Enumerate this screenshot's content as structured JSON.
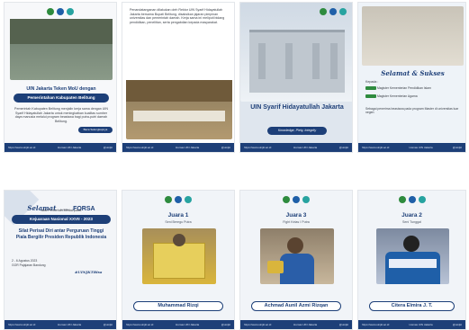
{
  "posts": [
    {
      "headline": "UIN Jakarta Teken MoU dengan",
      "headline2": "Pemerintahan Kabupaten Belitung",
      "body": "Pemerintah Kabupaten Belitung menjalin kerja sama dengan UIN Syarif Hidayatullah Jakarta untuk meningkatkan kualitas sumber daya manusia melalui program beasiswa bagi putra-putri daerah Belitung.",
      "button": "Baca Selengkapnya",
      "footer_left": "https://www.uinjkt.ac.id",
      "footer_mid": "Humas UIN Jakarta",
      "footer_right": "@uinjkt"
    },
    {
      "body": "Penandatanganan dilakukan oleh Rektor UIN Syarif Hidayatullah Jakarta bersama Bupati Belitung, disaksikan jajaran pimpinan universitas dan pemerintah daerah. Kerja sama ini meliputi bidang pendidikan, penelitian, serta pengabdian kepada masyarakat.",
      "footer_left": "https://www.uinjkt.ac.id",
      "footer_mid": "Humas UIN Jakarta",
      "footer_right": "@uinjkt"
    },
    {
      "title": "UIN Syarif Hidayatullah Jakarta",
      "tagline": "Knowledge, Piety, Integrity",
      "footer_left": "https://www.uinjkt.ac.id",
      "footer_mid": "Humas UIN Jakarta",
      "footer_right": "@uinjkt"
    },
    {
      "heading": "Selamat & Sukses",
      "intro": "Kepada :",
      "item1": "Magister Kementerian Pendidikan Islam",
      "item2": "Magister Kementerian Agama",
      "body": "Sebagai penerima beasiswa pada program Master di universitas luar negeri.",
      "footer_left": "https://www.uinjkt.ac.id",
      "footer_mid": "Humas UIN Jakarta",
      "footer_right": "@uinjkt"
    },
    {
      "selamat": "Selamat",
      "kepada": "kepada",
      "forsa": "FORSA",
      "subtitle": "atas Perolehan Medali pada",
      "event": "Kejuaraan Nasional XXVII - 2023",
      "desc": "Silat Perisai Diri antar Perguruan Tinggi Piala Bergilir Presiden Republik Indonesia",
      "date": "2 - 6 Agustus 2023",
      "venue": "GOR Pajajaran Bandung",
      "tag": "#UINJKTBisa",
      "footer_left": "https://www.uinjkt.ac.id",
      "footer_mid": "Humas UIN Jakarta",
      "footer_right": "@uinjkt"
    },
    {
      "rank": "Juara 1",
      "category": "Seni Beregu Putra",
      "name": "Muhammad Rizqi",
      "footer_left": "https://www.uinjkt.ac.id",
      "footer_mid": "Humas UIN Jakarta",
      "footer_right": "@uinjkt"
    },
    {
      "rank": "Juara 3",
      "category": "Fight Kelas I Putra",
      "name": "Achmad Aunil Azmi Rizqan",
      "footer_left": "https://www.uinjkt.ac.id",
      "footer_mid": "Humas UIN Jakarta",
      "footer_right": "@uinjkt"
    },
    {
      "rank": "Juara 2",
      "category": "Seni Tunggal",
      "name": "Citera Elmira J. T.",
      "footer_left": "https://www.uinjkt.ac.id",
      "footer_mid": "Humas UIN Jakarta",
      "footer_right": "@uinjkt"
    }
  ],
  "colors": {
    "navy": "#1d3f78",
    "green": "#2e8b3e",
    "gold": "#d9b53c"
  }
}
